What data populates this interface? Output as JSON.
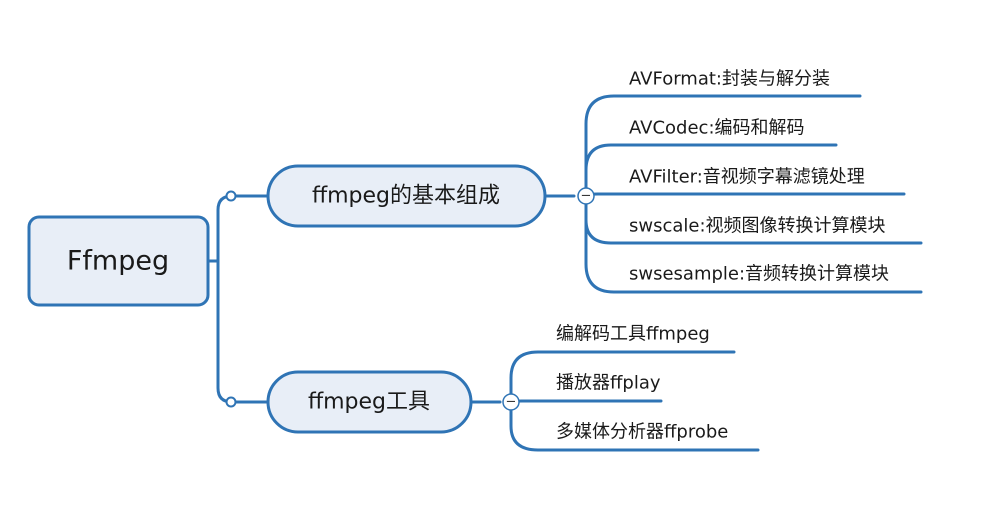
{
  "colors": {
    "stroke": "#2f74b5",
    "root_fill": "#e8eef7",
    "branch_fill": "#e8eef7",
    "text": "#1a1a1a",
    "collapse_fill": "#ffffff"
  },
  "mindmap": {
    "root": {
      "label": "Ffmpeg"
    },
    "branches": [
      {
        "label": "ffmpeg的基本组成",
        "collapse_symbol": "−",
        "children": [
          "AVFormat:封装与解分装",
          "AVCodec:编码和解码",
          "AVFilter:音视频字幕滤镜处理",
          "swscale:视频图像转换计算模块",
          "swsesample:音频转换计算模块"
        ]
      },
      {
        "label": "ffmpeg工具",
        "collapse_symbol": "−",
        "children": [
          "编解码工具ffmpeg",
          "播放器ffplay",
          "多媒体分析器ffprobe"
        ]
      }
    ]
  }
}
